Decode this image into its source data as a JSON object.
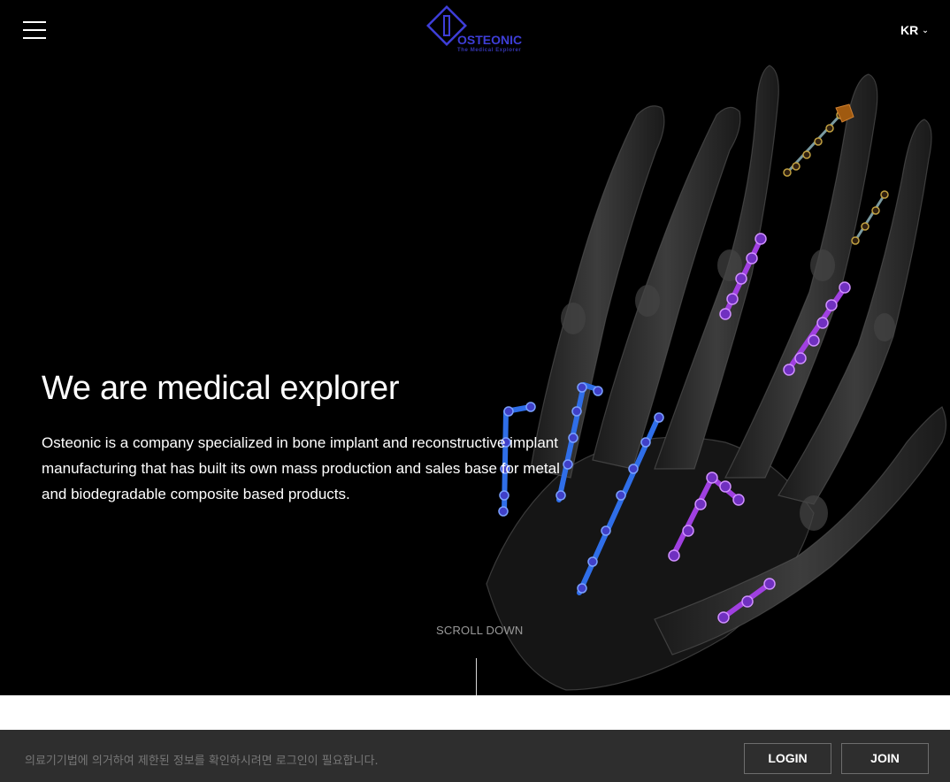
{
  "header": {
    "logo_text": "OSTEONIC",
    "logo_tagline": "The Medical Explorer",
    "language": "KR",
    "menu_icon": "hamburger-menu-icon",
    "language_icon": "chevron-down-icon"
  },
  "hero": {
    "headline": "We are medical explorer",
    "description": "Osteonic is a company specialized in bone implant and reconstructive implant manufacturing that has built its own mass production and sales base for metal and biodegradable composite based products.",
    "scroll_label": "SCROLL DOWN",
    "image": "hand-xray-with-implant-plates"
  },
  "footer_bar": {
    "notice": "의료기기법에 의거하여 제한된 정보를 확인하시려면 로그인이 필요합니다.",
    "login_label": "LOGIN",
    "join_label": "JOIN"
  },
  "colors": {
    "background": "#000000",
    "brand_blue": "#3e3ed8",
    "bottom_bar": "#2e2e2e",
    "implant_purple": "#a040e0",
    "implant_blue": "#2f6ee8",
    "implant_gold": "#b08a30"
  }
}
